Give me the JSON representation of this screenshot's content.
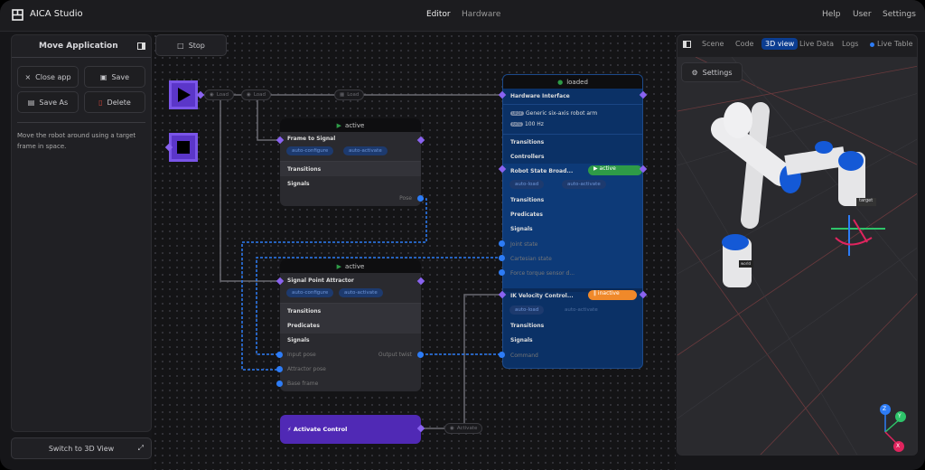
{
  "app": {
    "title": "AICA Studio",
    "nav": [
      "Editor",
      "Hardware"
    ],
    "right_nav": [
      "Help",
      "User",
      "Settings"
    ]
  },
  "sidebar": {
    "title": "Move Application",
    "buttons": {
      "close": "Close app",
      "save": "Save",
      "save_as": "Save As",
      "delete": "Delete"
    },
    "description": "Move the robot around using a target frame in space.",
    "switch_label": "Switch to 3D View"
  },
  "toolbar": {
    "stop_label": "Stop"
  },
  "pills": {
    "load1": "Load",
    "load2": "Load",
    "load3": "Load",
    "activate": "Activate"
  },
  "frame_to_signal": {
    "status": "active",
    "title": "Frame to Signal",
    "chips": [
      "auto-configure",
      "auto-activate"
    ],
    "sections": [
      "Transitions",
      "Signals"
    ],
    "output": "Pose"
  },
  "signal_point_attractor": {
    "status": "active",
    "title": "Signal Point Attractor",
    "chips": [
      "auto-configure",
      "auto-activate"
    ],
    "sections": [
      "Transitions",
      "Predicates",
      "Signals"
    ],
    "inputs": [
      "Input pose",
      "Attractor pose",
      "Base frame"
    ],
    "output": "Output twist"
  },
  "hardware": {
    "status": "loaded",
    "title": "Hardware Interface",
    "urdf_badge": "URDF",
    "urdf": "Generic six-axis robot arm",
    "rate_badge": "RATE",
    "rate": "100 Hz",
    "sections": [
      "Transitions",
      "Controllers"
    ],
    "robot_state": {
      "title": "Robot State Broad...",
      "status": "active",
      "chips": [
        "auto-load",
        "auto-activate"
      ],
      "sections": [
        "Transitions",
        "Predicates",
        "Signals"
      ],
      "outputs": [
        "Joint state",
        "Cartesian state",
        "Force torque sensor d..."
      ]
    },
    "ik": {
      "title": "IK Velocity Control...",
      "status": "inactive",
      "chips": [
        "auto-load",
        "auto-activate"
      ],
      "sections": [
        "Transitions",
        "Signals"
      ],
      "inputs": [
        "Command"
      ]
    }
  },
  "activate_control": {
    "title": "Activate Control"
  },
  "viewer": {
    "tabs": [
      "Scene",
      "Code",
      "3D view",
      "Live Data",
      "Logs",
      "Live Table"
    ],
    "active_tab": "3D view",
    "settings_label": "Settings",
    "labels": {
      "target": "target",
      "world": "world"
    },
    "axes": [
      "Z",
      "Y",
      "X"
    ]
  },
  "colors": {
    "accent": "#5b36c9",
    "active": "#2e9b47",
    "inactive": "#f0892a",
    "hw": "#0b3166",
    "port": "#2d7cf6"
  }
}
